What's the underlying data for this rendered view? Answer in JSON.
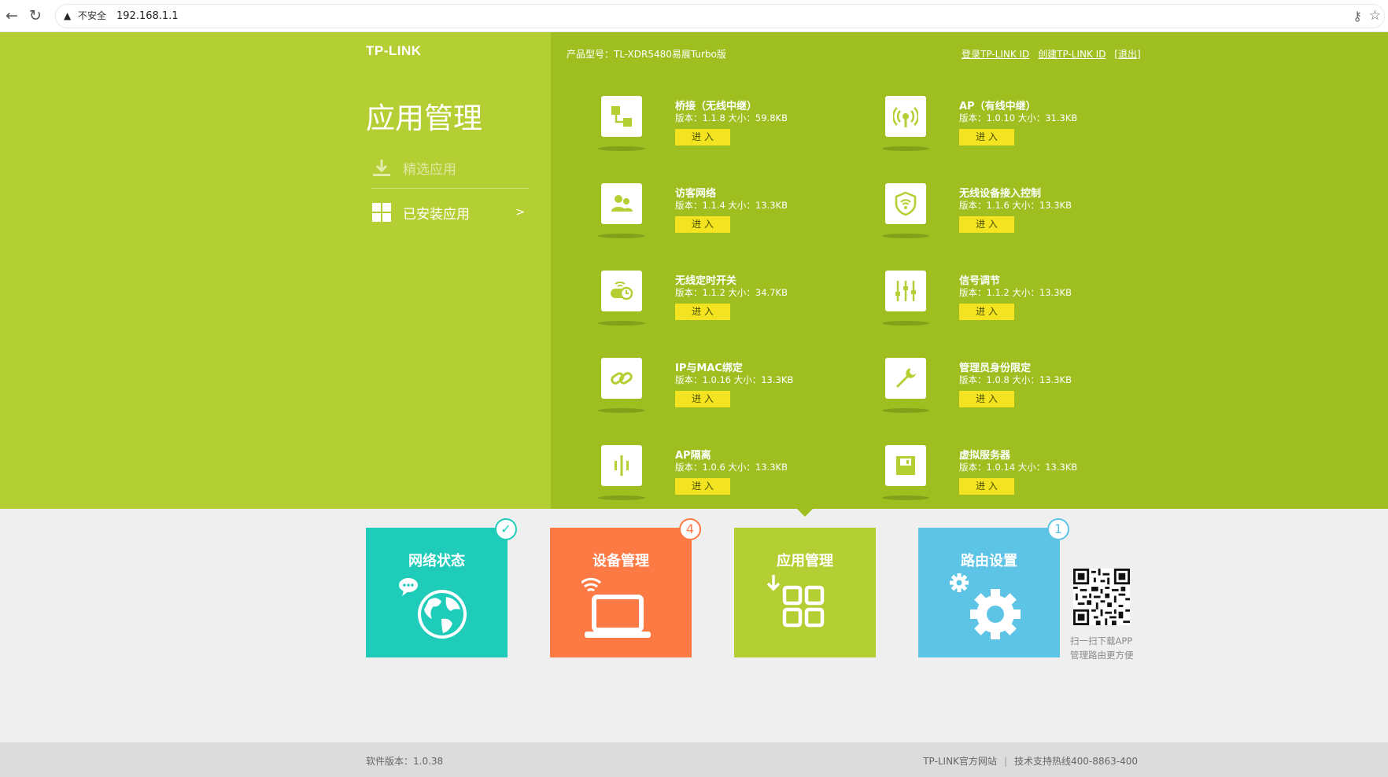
{
  "browser": {
    "security_label": "不安全",
    "url": "192.168.1.1"
  },
  "brand": {
    "logo": "TP-LINK"
  },
  "header": {
    "product": "产品型号：TL-XDR5480易展Turbo版",
    "links": [
      "登录TP-LINK ID",
      "创建TP-LINK ID",
      "[退出]"
    ]
  },
  "sidebar": {
    "title": "应用管理",
    "items": [
      {
        "label": "精选应用",
        "icon": "download-icon"
      },
      {
        "label": "已安装应用",
        "icon": "apps-grid-icon",
        "arrow": ">"
      }
    ]
  },
  "apps": [
    {
      "name": "桥接（无线中继）",
      "meta": "版本：1.1.8 大小：59.8KB",
      "button": "进 入",
      "icon": "bridge-icon"
    },
    {
      "name": "AP（有线中继）",
      "meta": "版本：1.0.10 大小：31.3KB",
      "button": "进 入",
      "icon": "antenna-icon"
    },
    {
      "name": "访客网络",
      "meta": "版本：1.1.4 大小：13.3KB",
      "button": "进 入",
      "icon": "guest-users-icon"
    },
    {
      "name": "无线设备接入控制",
      "meta": "版本：1.1.6 大小：13.3KB",
      "button": "进 入",
      "icon": "wifi-shield-icon"
    },
    {
      "name": "无线定时开关",
      "meta": "版本：1.1.2 大小：34.7KB",
      "button": "进 入",
      "icon": "timer-switch-icon"
    },
    {
      "name": "信号调节",
      "meta": "版本：1.1.2 大小：13.3KB",
      "button": "进 入",
      "icon": "signal-sliders-icon"
    },
    {
      "name": "IP与MAC绑定",
      "meta": "版本：1.0.16 大小：13.3KB",
      "button": "进 入",
      "icon": "link-icon"
    },
    {
      "name": "管理员身份限定",
      "meta": "版本：1.0.8 大小：13.3KB",
      "button": "进 入",
      "icon": "wrench-icon"
    },
    {
      "name": "AP隔离",
      "meta": "版本：1.0.6 大小：13.3KB",
      "button": "进 入",
      "icon": "ap-isolation-icon"
    },
    {
      "name": "虚拟服务器",
      "meta": "版本：1.0.14 大小：13.3KB",
      "button": "进 入",
      "icon": "server-icon"
    }
  ],
  "tiles": [
    {
      "title": "网络状态",
      "badge": "✓",
      "color": "#1fcbb9",
      "icon": "globe-chat-icon"
    },
    {
      "title": "设备管理",
      "badge": "4",
      "color": "#fe7a45",
      "icon": "laptop-wifi-icon"
    },
    {
      "title": "应用管理",
      "badge": "",
      "color": "#b3cf33",
      "icon": "app-grid-icon"
    },
    {
      "title": "路由设置",
      "badge": "1",
      "color": "#5dc4e6",
      "icon": "gear-icon"
    }
  ],
  "qr": {
    "caption_line1": "扫一扫下载APP",
    "caption_line2": "管理路由更方便"
  },
  "footer": {
    "software_version": "软件版本：1.0.38",
    "official_site": "TP-LINK官方网站",
    "support": "技术支持热线400-8863-400"
  },
  "colors": {
    "left_panel": "#b4cf33",
    "right_panel": "#9ebf1f",
    "enter_button": "#f4e320"
  }
}
